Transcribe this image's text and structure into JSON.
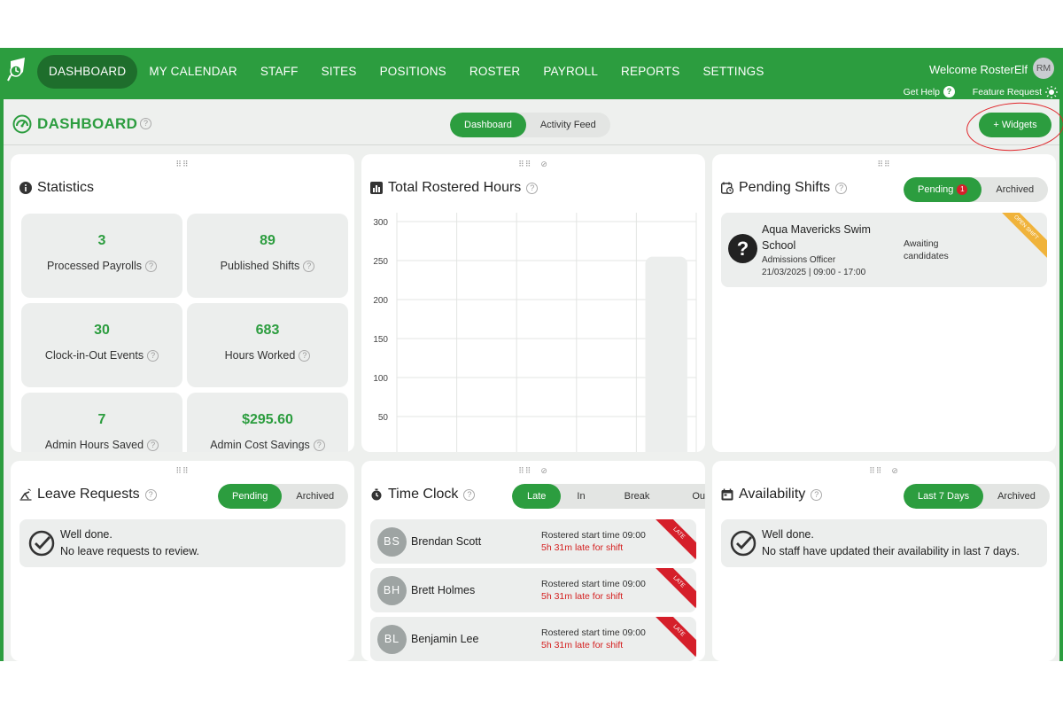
{
  "colors": {
    "brand": "#2c9d3f",
    "brand_dark": "#1e6e2c",
    "late_red": "#d51f2a",
    "open_shift": "#f0b33b"
  },
  "nav": {
    "items": [
      "DASHBOARD",
      "MY CALENDAR",
      "STAFF",
      "SITES",
      "POSITIONS",
      "ROSTER",
      "PAYROLL",
      "REPORTS",
      "SETTINGS"
    ],
    "active": "DASHBOARD",
    "welcome": "Welcome RosterElf",
    "avatar_initials": "RM",
    "get_help": "Get Help",
    "feature_request": "Feature Request"
  },
  "header": {
    "title": "DASHBOARD",
    "tabs": [
      "Dashboard",
      "Activity Feed"
    ],
    "active_tab": "Dashboard",
    "widgets_button": "+ Widgets"
  },
  "statistics": {
    "title": "Statistics",
    "items": [
      {
        "value": "3",
        "label": "Processed Payrolls"
      },
      {
        "value": "89",
        "label": "Published Shifts"
      },
      {
        "value": "30",
        "label": "Clock-in-Out Events"
      },
      {
        "value": "683",
        "label": "Hours Worked"
      },
      {
        "value": "7",
        "label": "Admin Hours Saved"
      },
      {
        "value": "$295.60",
        "label": "Admin Cost Savings"
      }
    ]
  },
  "rostered_hours": {
    "title": "Total Rostered Hours",
    "chart_data": {
      "type": "bar",
      "categories": [
        "",
        "",
        "",
        "",
        ""
      ],
      "values": [
        3,
        3,
        2,
        0,
        255
      ],
      "ylim": [
        0,
        300
      ],
      "yticks": [
        "300",
        "250",
        "200",
        "150",
        "100",
        "50"
      ],
      "title": "",
      "xlabel": "",
      "ylabel": "",
      "grid": true
    }
  },
  "pending_shifts": {
    "title": "Pending Shifts",
    "tabs": [
      "Pending",
      "Archived"
    ],
    "active_tab": "Pending",
    "badge": "1",
    "item": {
      "name": "Aqua Mavericks Swim School",
      "role": "Admissions Officer",
      "time": "21/03/2025 | 09:00 - 17:00",
      "status": "Awaiting candidates",
      "ribbon": "OPEN SHIFT"
    }
  },
  "leave_requests": {
    "title": "Leave Requests",
    "tabs": [
      "Pending",
      "Archived"
    ],
    "active_tab": "Pending",
    "empty_line1": "Well done.",
    "empty_line2": "No leave requests to review."
  },
  "time_clock": {
    "title": "Time Clock",
    "tabs": [
      "Late",
      "In",
      "Break",
      "Out"
    ],
    "active_tab": "Late",
    "rows": [
      {
        "initials": "BS",
        "name": "Brendan Scott",
        "start": "Rostered start time 09:00",
        "late": "5h 31m late for shift",
        "ribbon": "LATE"
      },
      {
        "initials": "BH",
        "name": "Brett Holmes",
        "start": "Rostered start time 09:00",
        "late": "5h 31m late for shift",
        "ribbon": "LATE"
      },
      {
        "initials": "BL",
        "name": "Benjamin Lee",
        "start": "Rostered start time 09:00",
        "late": "5h 31m late for shift",
        "ribbon": "LATE"
      }
    ]
  },
  "availability": {
    "title": "Availability",
    "tabs": [
      "Last 7 Days",
      "Archived"
    ],
    "active_tab": "Last 7 Days",
    "empty_line1": "Well done.",
    "empty_line2": "No staff have updated their availability in last 7 days."
  }
}
